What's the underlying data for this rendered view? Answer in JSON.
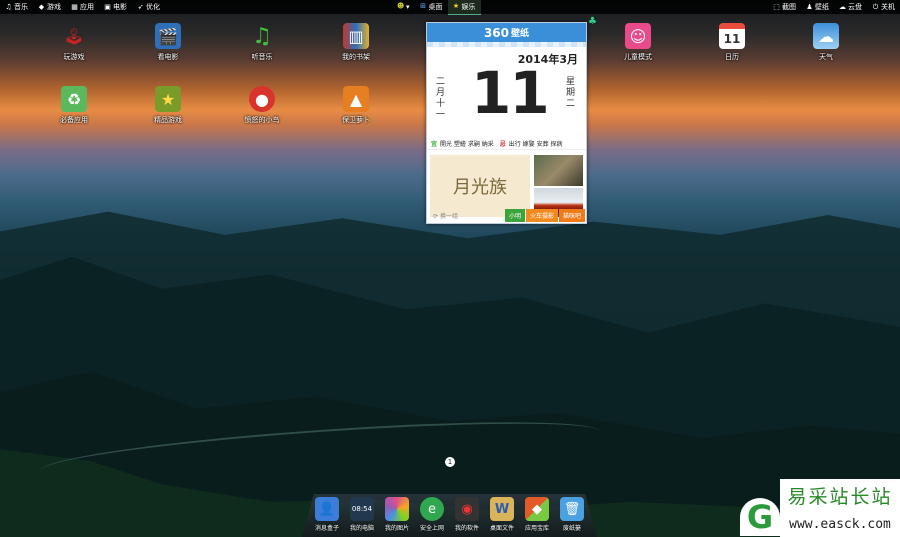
{
  "topbar": {
    "left": [
      {
        "icon": "music-note-icon",
        "label": "音乐"
      },
      {
        "icon": "gamepad-icon",
        "label": "游戏"
      },
      {
        "icon": "apps-icon",
        "label": "应用"
      },
      {
        "icon": "film-icon",
        "label": "电影"
      },
      {
        "icon": "rocket-icon",
        "label": "优化"
      }
    ],
    "middle": [
      {
        "icon": "smiley-icon",
        "label": ""
      },
      {
        "icon": "windows-icon",
        "label": "桌面"
      },
      {
        "icon": "star-person-icon",
        "label": "娱乐"
      }
    ],
    "right": [
      {
        "icon": "screenshot-icon",
        "label": "截图"
      },
      {
        "icon": "tshirt-icon",
        "label": "壁纸"
      },
      {
        "icon": "cloud-icon",
        "label": "云盘"
      },
      {
        "icon": "power-icon",
        "label": "关机"
      }
    ]
  },
  "desktop_icons": [
    {
      "name": "玩游戏",
      "icon": "joystick-icon",
      "color": "#d9d9d9"
    },
    {
      "name": "看电影",
      "icon": "clapperboard-icon",
      "color": "#4a90d9"
    },
    {
      "name": "听音乐",
      "icon": "music-note-icon",
      "color": "#3fbf3f"
    },
    {
      "name": "我的书架",
      "icon": "books-icon",
      "color": "#c0392b"
    },
    {
      "name": "儿童模式",
      "icon": "child-face-icon",
      "color": "#e84a8a"
    },
    {
      "name": "日历",
      "icon": "calendar-icon",
      "color": "#e74c3c"
    },
    {
      "name": "天气",
      "icon": "weather-icon",
      "color": "#5aa7e0"
    },
    {
      "name": "必备应用",
      "icon": "recycle-bag-icon",
      "color": "#5cb85c"
    },
    {
      "name": "精品游戏",
      "icon": "star-badge-icon",
      "color": "#c9b24a"
    },
    {
      "name": "愤怒的小鸟",
      "icon": "angry-bird-icon",
      "color": "#d9342b"
    },
    {
      "name": "保卫萝卜",
      "icon": "carrot-game-icon",
      "color": "#e67e22"
    }
  ],
  "calendar": {
    "brand": "360",
    "brand_sub": "壁纸",
    "year_month": "2014年3月",
    "day": "11",
    "lunar": "二月十一",
    "weekday": "星期二",
    "yi_label": "宜",
    "yi": "開光 塑繪 求嗣 納采",
    "ji_label": "忌",
    "ji": "出行 嫁娶 安葬 探病",
    "picture_text": "月光族",
    "next_label": "换一组",
    "btn1": "小明",
    "btn2": "火车摄影",
    "btn3": "猫咪吧"
  },
  "page_indicator": "1",
  "dock": [
    {
      "name": "消息盒子",
      "icon": "message-box-icon",
      "color": "#3b7dd8"
    },
    {
      "name": "我的电脑",
      "icon": "monitor-icon",
      "color": "#22384f"
    },
    {
      "name": "我的图片",
      "icon": "photos-icon",
      "color": "#e0508a"
    },
    {
      "name": "安全上网",
      "icon": "safe-browser-icon",
      "color": "#2fa84f"
    },
    {
      "name": "我的软件",
      "icon": "software-icon",
      "color": "#333333"
    },
    {
      "name": "桌面文件",
      "icon": "word-doc-icon",
      "color": "#d9b45a"
    },
    {
      "name": "应用宝库",
      "icon": "app-cube-icon",
      "color": "#e05a2a"
    },
    {
      "name": "废纸篓",
      "icon": "trash-can-icon",
      "color": "#4aa0e0"
    }
  ],
  "watermark": {
    "logo": "G",
    "title": "易采站长站",
    "url": "www.easck.com"
  }
}
